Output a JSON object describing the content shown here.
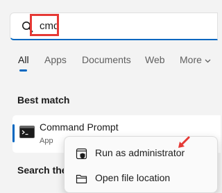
{
  "search": {
    "query": "cmd"
  },
  "tabs": [
    {
      "label": "All"
    },
    {
      "label": "Apps"
    },
    {
      "label": "Documents"
    },
    {
      "label": "Web"
    },
    {
      "label": "More"
    }
  ],
  "sections": {
    "best_match": "Best match",
    "search_the_web_partial": "Search the"
  },
  "best_result": {
    "title": "Command Prompt",
    "type": "App"
  },
  "context_menu": {
    "items": [
      {
        "label": "Run as administrator"
      },
      {
        "label": "Open file location"
      }
    ]
  },
  "colors": {
    "accent": "#0067c0",
    "annotation_red": "#e53935"
  }
}
